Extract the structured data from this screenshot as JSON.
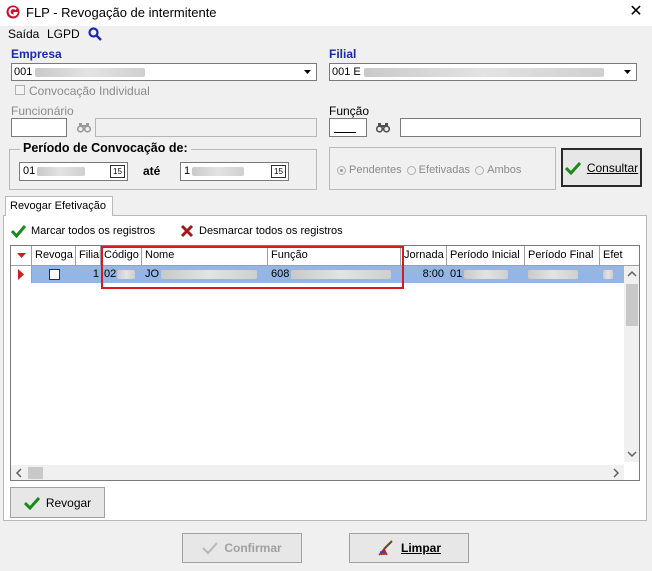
{
  "window": {
    "title": "FLP - Revogação de intermitente"
  },
  "menu": {
    "items": [
      "Saída",
      "LGPD"
    ]
  },
  "empresa": {
    "label": "Empresa",
    "value": "001"
  },
  "filial": {
    "label": "Filial",
    "value": "001 E"
  },
  "convocacao_individual": {
    "label": "Convocação Individual"
  },
  "funcionario": {
    "label": "Funcionário"
  },
  "funcao": {
    "label": "Função"
  },
  "periodo": {
    "label": "Período de Convocação de:",
    "from": "01",
    "sep": "até",
    "to": "1",
    "cal_label": "15"
  },
  "status_filter": {
    "options": [
      "Pendentes",
      "Efetivadas",
      "Ambos"
    ],
    "selected": "Pendentes"
  },
  "consultar_button": {
    "label": "Consultar"
  },
  "tab": {
    "label": "Revogar Efetivação"
  },
  "actions": {
    "mark_all": "Marcar todos os registros",
    "unmark_all": "Desmarcar todos os registros"
  },
  "grid": {
    "columns": [
      "Revoga",
      "Filial",
      "Código",
      "Nome",
      "Função",
      "Jornada",
      "Período Inicial",
      "Período Final",
      "Efet"
    ],
    "rows": [
      {
        "revoga": "",
        "filial": "1",
        "codigo": "02",
        "nome": "JO",
        "funcao": "608",
        "jornada": "8:00",
        "periodo_inicial": "01",
        "periodo_final": ""
      }
    ]
  },
  "revogar_button": {
    "label": "Revogar"
  },
  "confirmar_button": {
    "label": "Confirmar"
  },
  "limpar_button": {
    "label": "Limpar"
  },
  "colors": {
    "accent_blue": "#1a2aa8",
    "selected_row": "#94b6e6",
    "highlight_red": "#d41c1c"
  }
}
